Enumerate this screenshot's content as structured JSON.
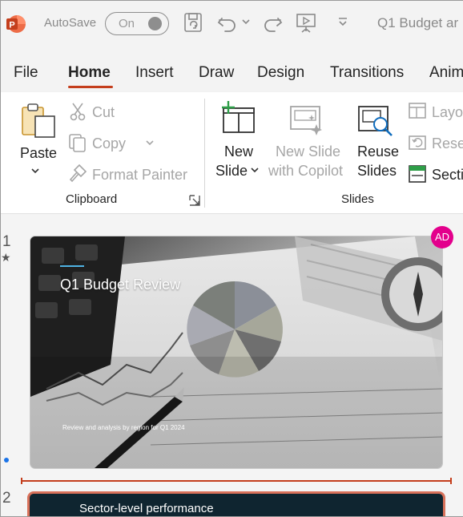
{
  "titlebar": {
    "app_icon": "powerpoint-logo",
    "autosave_label": "AutoSave",
    "autosave_state": "On",
    "document_title": "Q1 Budget ar",
    "icons": [
      "save-icon",
      "undo-icon",
      "redo-icon",
      "present-icon",
      "customize-toolbar-icon"
    ]
  },
  "tabs": [
    {
      "label": "File"
    },
    {
      "label": "Home",
      "active": true
    },
    {
      "label": "Insert"
    },
    {
      "label": "Draw"
    },
    {
      "label": "Design"
    },
    {
      "label": "Transitions"
    },
    {
      "label": "Anim"
    }
  ],
  "ribbon": {
    "clipboard": {
      "group_label": "Clipboard",
      "paste": "Paste",
      "cut": "Cut",
      "copy": "Copy",
      "format_painter": "Format Painter"
    },
    "slides": {
      "group_label": "Slides",
      "new_slide_line1": "New",
      "new_slide_line2": "Slide",
      "copilot_line1": "New Slide",
      "copilot_line2": "with Copilot",
      "reuse_line1": "Reuse",
      "reuse_line2": "Slides",
      "layout": "Layo",
      "reset": "Rese",
      "section": "Secti"
    }
  },
  "slides_pane": {
    "slide1_number": "1",
    "slide1_star": "★",
    "slide1_title": "Q1 Budget Review",
    "slide1_subtitle": "Review and analysis by region for Q1 2024",
    "slide2_number": "2",
    "slide2_text": "Sector-level performance",
    "avatar_initials": "AD"
  },
  "colors": {
    "accent": "#c43e1c",
    "avatar": "#e3008c",
    "titlebar_bg": "#f3f3f3"
  }
}
